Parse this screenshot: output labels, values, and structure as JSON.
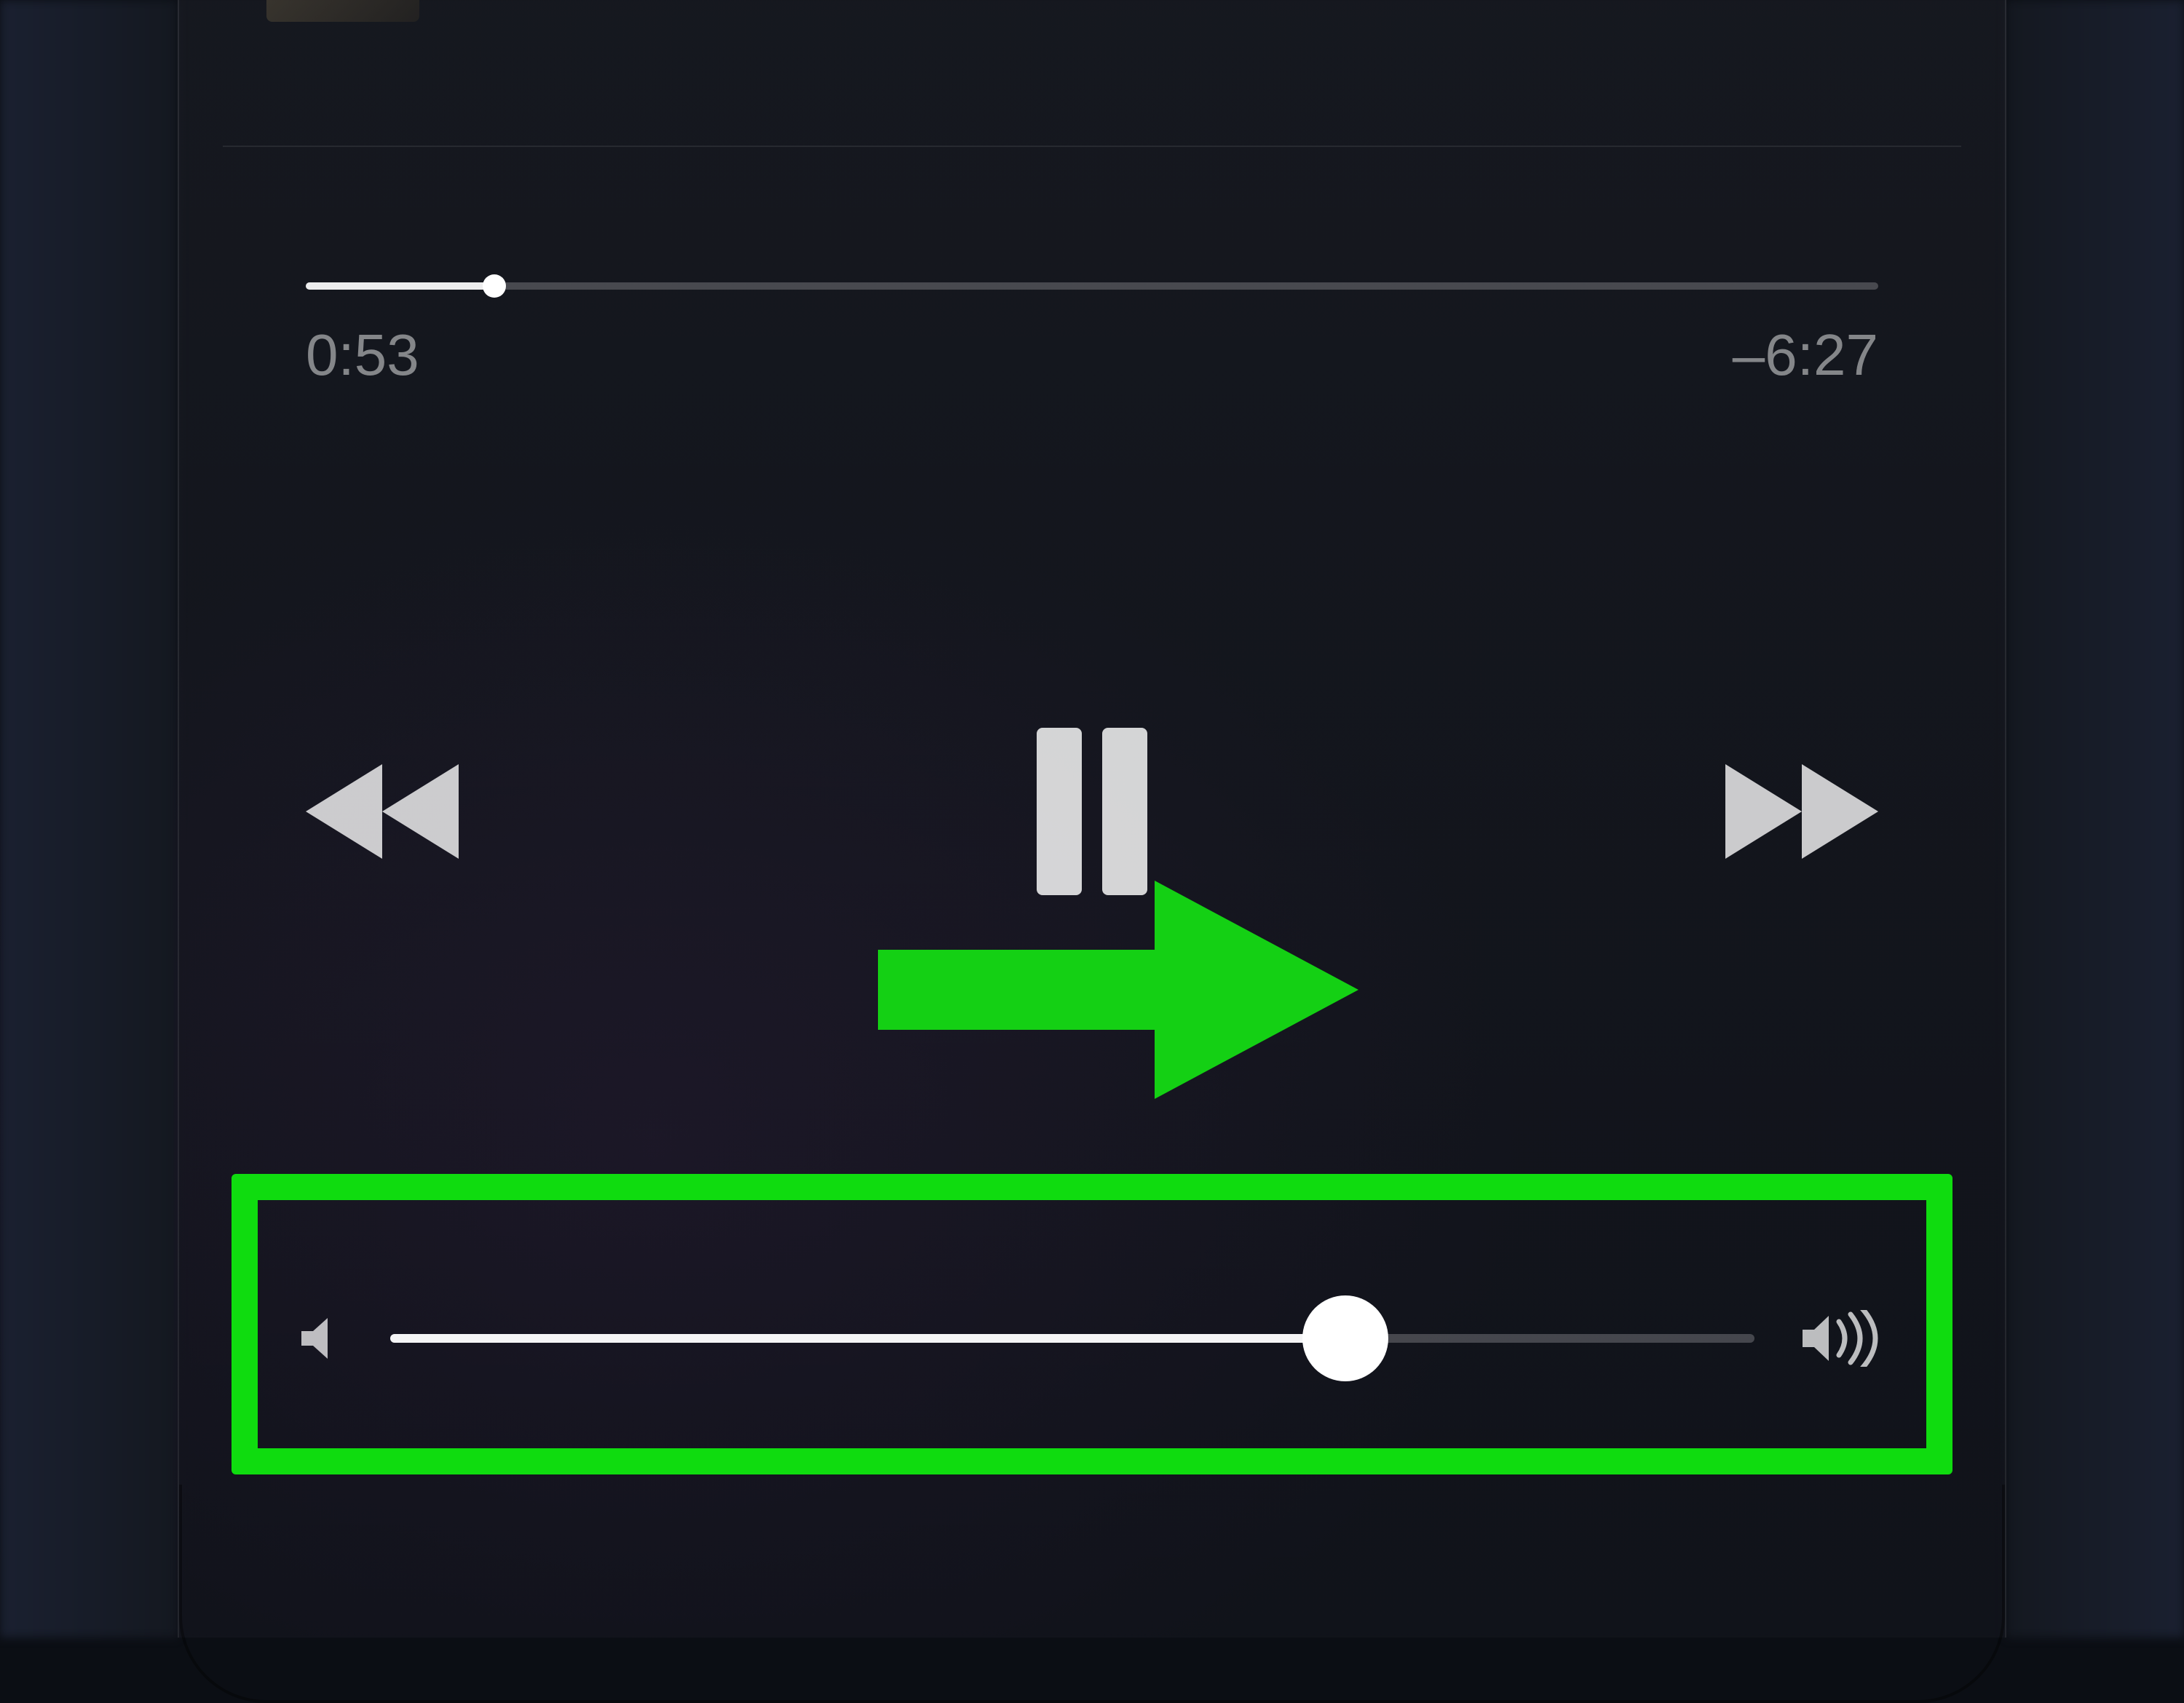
{
  "player": {
    "elapsed": "0:53",
    "remaining": "–6:27",
    "scrub_percent": 12,
    "volume_percent": 70
  },
  "annotation": {
    "highlight_color": "#0fdc0f",
    "arrow_color": "#14d014"
  }
}
